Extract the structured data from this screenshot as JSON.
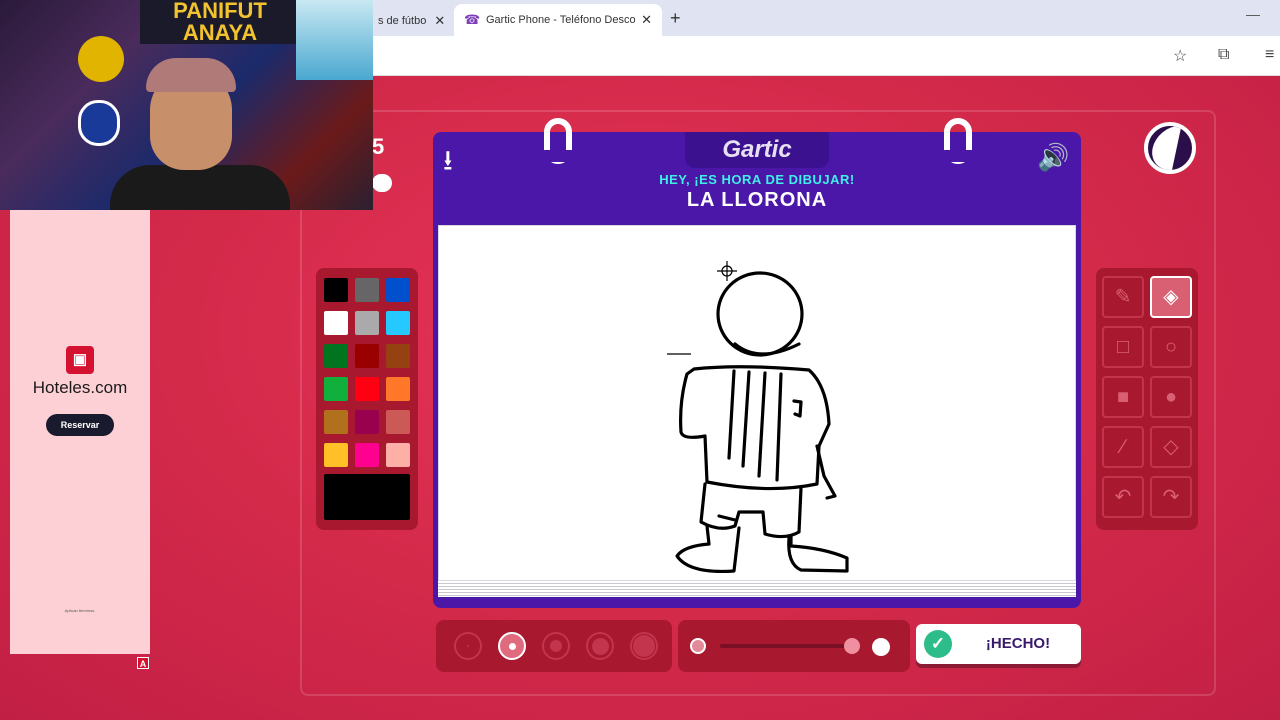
{
  "browser": {
    "inactive_tab_title": "s de fútbo",
    "active_tab_title": "Gartic Phone - Teléfono Descon",
    "close_glyph": "✕",
    "newtab_glyph": "+",
    "minimize_glyph": "—"
  },
  "toolbar_icons": [
    "star-icon",
    "extensions-icon",
    "media-icon"
  ],
  "webcam": {
    "banner_text": "PANIFUT ANAYA"
  },
  "ad": {
    "brand": "Hoteles.com",
    "button_label": "Reservar",
    "fine_print": "Aplican términos.",
    "marker": "A"
  },
  "partial_text": "5",
  "game": {
    "logo": "Gartic",
    "subtitle": "HEY, ¡ES HORA DE DIBUJAR!",
    "word": "LA LLORONA",
    "done_label": "¡HECHO!"
  },
  "palette": {
    "colors": [
      "#000000",
      "#666666",
      "#0050cd",
      "#ffffff",
      "#aaaaaa",
      "#26c9ff",
      "#017420",
      "#990000",
      "#964112",
      "#11b03c",
      "#ff0013",
      "#ff7829",
      "#b0701c",
      "#99004e",
      "#cb5a57",
      "#ffc126",
      "#ff008f",
      "#feafa8"
    ],
    "current_color": "#000000"
  },
  "tools": {
    "active": "eraser",
    "items": [
      "pencil",
      "eraser",
      "rectangle-outline",
      "ellipse-outline",
      "rectangle-filled",
      "ellipse-filled",
      "line",
      "fill",
      "undo",
      "redo"
    ]
  },
  "brush_sizes": {
    "selected_index": 1,
    "count": 5
  },
  "opacity": {
    "value": 1.0
  }
}
